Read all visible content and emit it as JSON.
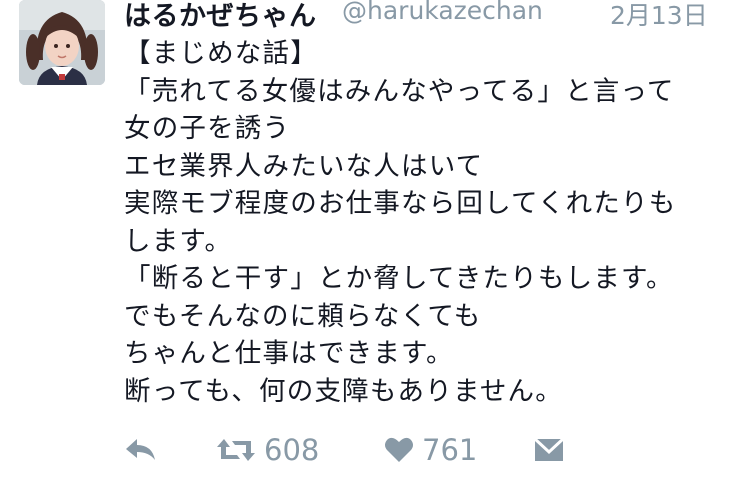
{
  "tweet": {
    "display_name": "はるかぜちゃん",
    "handle": "@harukazechan",
    "date": "2月13日",
    "lines": [
      "【まじめな話】",
      "「売れてる女優はみんなやってる」と言って",
      "女の子を誘う",
      "エセ業界人みたいな人はいて",
      "実際モブ程度のお仕事なら回してくれたりも",
      "します。",
      "「断ると干す」とか脅してきたりもします。",
      "でもそんなのに頼らなくても",
      "ちゃんと仕事はできます。",
      "断っても、何の支障もありません。"
    ]
  },
  "actions": {
    "reply_icon": "reply-icon",
    "retweet_icon": "retweet-icon",
    "retweet_count": "608",
    "like_icon": "heart-icon",
    "like_count": "761",
    "dm_icon": "envelope-icon"
  },
  "colors": {
    "text": "#141823",
    "muted": "#8899a6",
    "background": "#ffffff"
  }
}
